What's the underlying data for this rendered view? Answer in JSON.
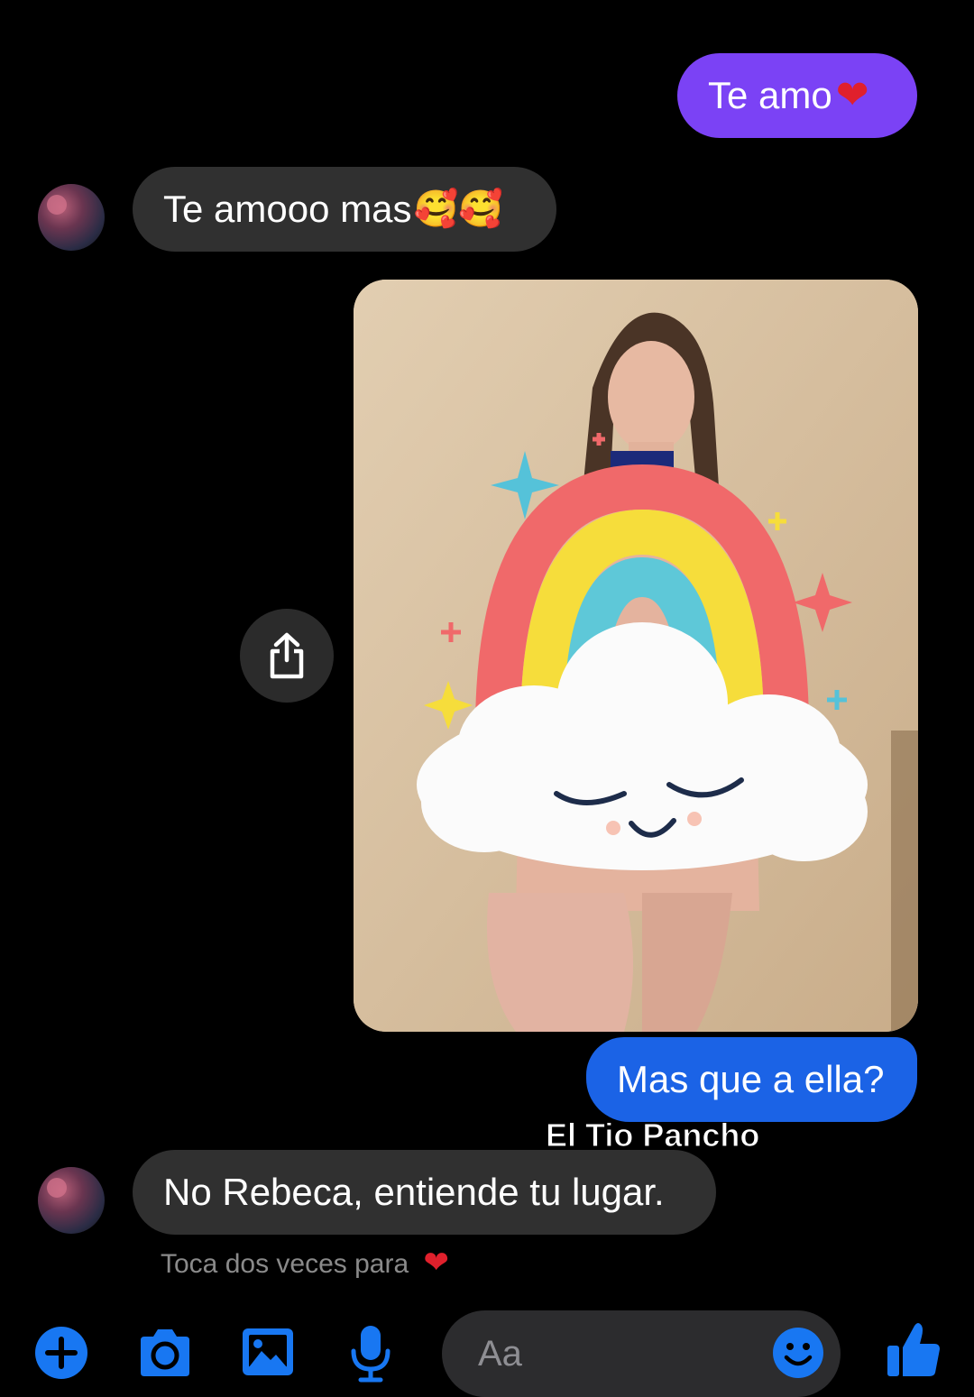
{
  "messages": {
    "m1": {
      "text": "Te amo",
      "emoji": "❤"
    },
    "m2": {
      "text": "Te amooo mas",
      "emoji": "🥰🥰"
    },
    "m3": {
      "text": "Mas que a ella?"
    },
    "m4": {
      "text": "No Rebeca, entiende tu lugar."
    }
  },
  "watermark": "El Tio Pancho",
  "hint": {
    "text": "Toca dos veces para",
    "emoji": "❤"
  },
  "composer": {
    "placeholder": "Aa"
  },
  "icons": [
    "plus-circle-icon",
    "camera-icon",
    "gallery-icon",
    "microphone-icon",
    "emoji-icon",
    "thumbs-up-icon",
    "share-icon"
  ],
  "colors": {
    "accent_purple": "#7b42f5",
    "accent_blue": "#1b63e6",
    "incoming_bubble": "#303030",
    "icon_blue": "#1877f2"
  }
}
